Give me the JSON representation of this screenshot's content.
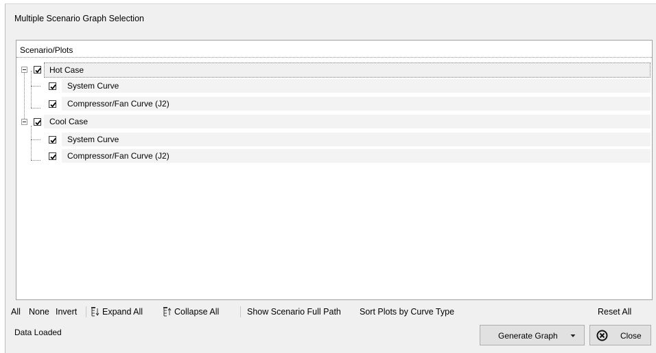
{
  "window": {
    "title": "Multiple Scenario Graph Selection"
  },
  "tree": {
    "header": "Scenario/Plots",
    "scenarios": [
      {
        "label": "Hot Case",
        "checked": true,
        "expanded": true,
        "selected": true,
        "plots": [
          {
            "label": "System Curve",
            "checked": true
          },
          {
            "label": "Compressor/Fan Curve (J2)",
            "checked": true
          }
        ]
      },
      {
        "label": "Cool Case",
        "checked": true,
        "expanded": true,
        "selected": false,
        "plots": [
          {
            "label": "System Curve",
            "checked": true
          },
          {
            "label": "Compressor/Fan Curve (J2)",
            "checked": true
          }
        ]
      }
    ]
  },
  "toolbar": {
    "all": "All",
    "none": "None",
    "invert": "Invert",
    "expand_all": "Expand All",
    "collapse_all": "Collapse All",
    "show_full_path": "Show Scenario Full Path",
    "sort_plots": "Sort Plots by Curve Type",
    "reset_all": "Reset All"
  },
  "status": {
    "text": "Data Loaded"
  },
  "buttons": {
    "generate": "Generate Graph",
    "close": "Close"
  },
  "icons": {
    "expand": "expand-all-icon",
    "collapse": "collapse-all-icon",
    "close": "close-circle-x-icon",
    "dropdown": "dropdown-arrow-icon"
  }
}
